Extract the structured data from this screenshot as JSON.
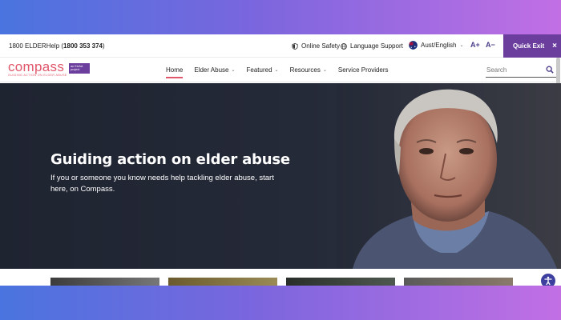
{
  "utility": {
    "phone_label": "1800 ELDERHelp (",
    "phone_number": "1800 353 374",
    "phone_close": ")",
    "online_safety": "Online Safety",
    "language_support": "Language Support",
    "locale": "Aust/English",
    "text_larger": "A+",
    "text_smaller": "A−",
    "quick_exit": "Quick Exit",
    "quick_exit_close": "×"
  },
  "logo": {
    "word": "compass",
    "tagline": "GUIDING ACTION ON ELDER ABUSE",
    "badge": "an EAAA project"
  },
  "nav": {
    "items": [
      {
        "label": "Home",
        "active": true,
        "dropdown": false
      },
      {
        "label": "Elder Abuse",
        "dropdown": true
      },
      {
        "label": "Featured",
        "dropdown": true
      },
      {
        "label": "Resources",
        "dropdown": true
      },
      {
        "label": "Service Providers",
        "dropdown": false
      }
    ],
    "search_placeholder": "Search"
  },
  "hero": {
    "title": "Guiding action on elder abuse",
    "subtitle": "If you or someone you know needs help tackling elder abuse, start here, on Compass."
  },
  "colors": {
    "brand_pink": "#e0566a",
    "brand_purple": "#6b3e9e",
    "hero_bg": "#232835"
  },
  "icons": [
    "shield-icon",
    "globe-icon",
    "australia-flag-icon",
    "chevron-down-icon",
    "search-icon",
    "close-icon",
    "accessibility-icon"
  ]
}
